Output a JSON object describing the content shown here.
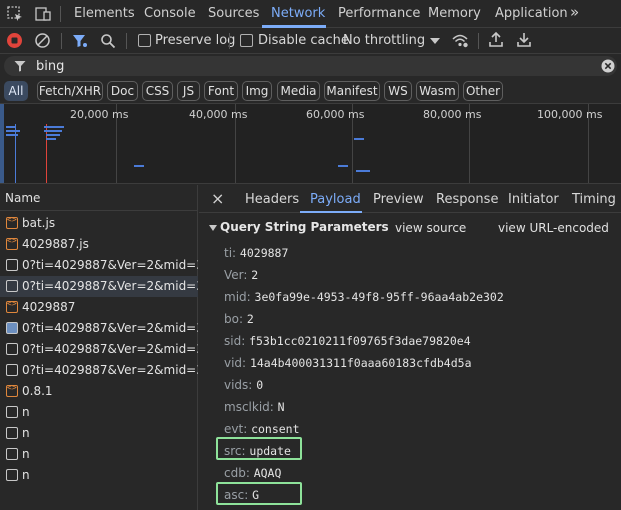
{
  "tabs": [
    {
      "label": "Elements"
    },
    {
      "label": "Console"
    },
    {
      "label": "Sources"
    },
    {
      "label": "Network"
    },
    {
      "label": "Performance"
    },
    {
      "label": "Memory"
    },
    {
      "label": "Application"
    }
  ],
  "tabs_more": "»",
  "toolbar": {
    "preserve_log": "Preserve log",
    "disable_cache": "Disable cache",
    "throttling": "No throttling"
  },
  "filter": {
    "value": "bing"
  },
  "chips": [
    "All",
    "Fetch/XHR",
    "Doc",
    "CSS",
    "JS",
    "Font",
    "Img",
    "Media",
    "Manifest",
    "WS",
    "Wasm",
    "Other"
  ],
  "overview": {
    "ticks": [
      "20,000 ms",
      "40,000 ms",
      "60,000 ms",
      "80,000 ms",
      "100,000 ms"
    ]
  },
  "requests": {
    "header": "Name",
    "rows": [
      {
        "name": "bat.js",
        "icon": "js"
      },
      {
        "name": "4029887.js",
        "icon": "js"
      },
      {
        "name": "0?ti=4029887&Ver=2&mid=3...",
        "icon": "doc"
      },
      {
        "name": "0?ti=4029887&Ver=2&mid=3...",
        "icon": "doc"
      },
      {
        "name": "4029887",
        "icon": "js"
      },
      {
        "name": "0?ti=4029887&Ver=2&mid=3...",
        "icon": "img"
      },
      {
        "name": "0?ti=4029887&Ver=2&mid=3...",
        "icon": "doc"
      },
      {
        "name": "0?ti=4029887&Ver=2&mid=3...",
        "icon": "doc"
      },
      {
        "name": "0.8.1",
        "icon": "js"
      },
      {
        "name": "n",
        "icon": "doc"
      },
      {
        "name": "n",
        "icon": "doc"
      },
      {
        "name": "n",
        "icon": "doc"
      },
      {
        "name": "n",
        "icon": "doc"
      }
    ]
  },
  "detail": {
    "close": "×",
    "tabs": [
      "Headers",
      "Payload",
      "Preview",
      "Response",
      "Initiator",
      "Timing"
    ],
    "section_title": "Query String Parameters",
    "view_source": "view source",
    "view_url_encoded": "view URL-encoded",
    "params": [
      {
        "key": "ti:",
        "value": "4029887"
      },
      {
        "key": "Ver:",
        "value": "2"
      },
      {
        "key": "mid:",
        "value": "3e0fa99e-4953-49f8-95ff-96aa4ab2e302"
      },
      {
        "key": "bo:",
        "value": "2"
      },
      {
        "key": "sid:",
        "value": "f53b1cc0210211f09765f3dae79820e4"
      },
      {
        "key": "vid:",
        "value": "14a4b400031311f0aaa60183cfdb4d5a"
      },
      {
        "key": "vids:",
        "value": "0"
      },
      {
        "key": "msclkid:",
        "value": "N"
      },
      {
        "key": "evt:",
        "value": "consent"
      },
      {
        "key": "src:",
        "value": "update"
      },
      {
        "key": "cdb:",
        "value": "AQAQ"
      },
      {
        "key": "asc:",
        "value": "G"
      }
    ]
  }
}
